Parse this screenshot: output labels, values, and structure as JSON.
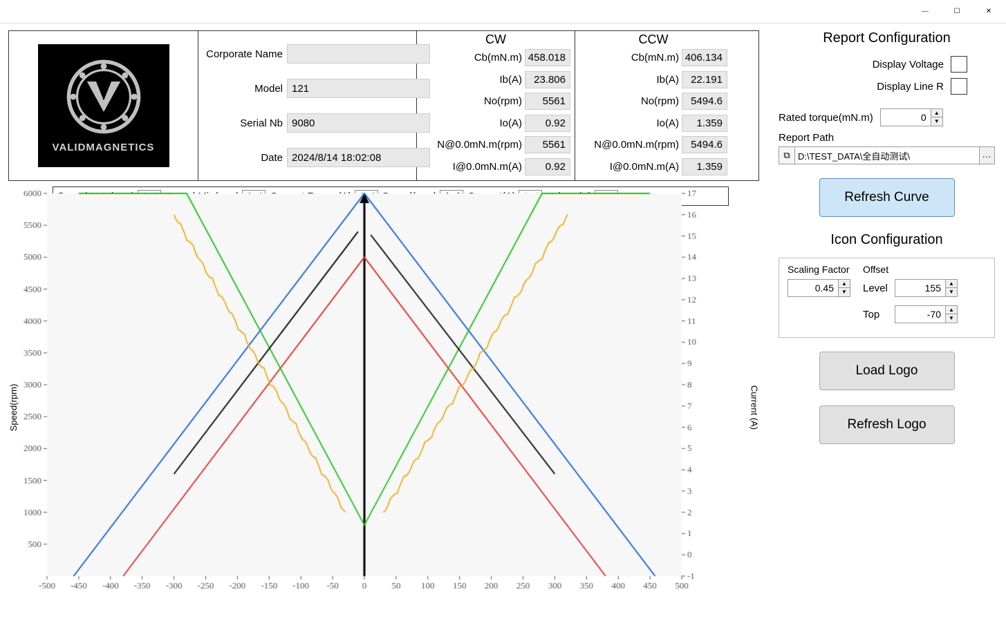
{
  "window": {
    "minimize": "—",
    "maximize": "☐",
    "close": "✕"
  },
  "logo_text": "VALIDMAGNETICS",
  "form": {
    "corp_label": "Corporate Name",
    "corp_value": "",
    "model_label": "Model",
    "model_value": "121",
    "serial_label": "Serial Nb",
    "serial_value": "9080",
    "date_label": "Date",
    "date_value": "2024/8/14 18:02:08"
  },
  "cw": {
    "header": "CW",
    "rows": [
      {
        "label": "Cb(mN.m)",
        "value": "458.018"
      },
      {
        "label": "Ib(A)",
        "value": "23.806"
      },
      {
        "label": "No(rpm)",
        "value": "5561"
      },
      {
        "label": "Io(A)",
        "value": "0.92"
      },
      {
        "label": "N@0.0mN.m(rpm)",
        "value": "5561"
      },
      {
        "label": "I@0.0mN.m(A)",
        "value": "0.92"
      }
    ]
  },
  "ccw": {
    "header": "CCW",
    "rows": [
      {
        "label": "Cb(mN.m)",
        "value": "406.134"
      },
      {
        "label": "Ib(A)",
        "value": "22.191"
      },
      {
        "label": "No(rpm)",
        "value": "5494.6"
      },
      {
        "label": "Io(A)",
        "value": "1.359"
      },
      {
        "label": "N@0.0mN.m(rpm)",
        "value": "5494.6"
      },
      {
        "label": "I@0.0mN.m(A)",
        "value": "1.359"
      }
    ]
  },
  "legend": [
    {
      "name": "Speed Max(rpm)",
      "color": "#1060d0"
    },
    {
      "name": "Speed Min(rpm)",
      "color": "#e03030"
    },
    {
      "name": "Current Range(A)",
      "color": "#20c020"
    },
    {
      "name": "Speed(rpm)",
      "color": "#000000"
    },
    {
      "name": "Current(A)",
      "color": "#e8b020"
    },
    {
      "name": "Volage(V)",
      "color": "#c0a0e0"
    }
  ],
  "axis": {
    "y_left": "Speed(rpm)",
    "y_right": "Current (A)"
  },
  "report_cfg": {
    "title": "Report Configuration",
    "disp_voltage": "Display Voltage",
    "disp_line_r": "Display Line R",
    "rated_torque_label": "Rated torque(mN.m)",
    "rated_torque_value": "0",
    "report_path_label": "Report Path",
    "report_path_value": "D:\\TEST_DATA\\全自动测试\\",
    "refresh_curve": "Refresh Curve"
  },
  "icon_cfg": {
    "title": "Icon Configuration",
    "scaling_factor_label": "Scaling Factor",
    "scaling_factor_value": "0.45",
    "offset_label": "Offset",
    "level_label": "Level",
    "level_value": "155",
    "top_label": "Top",
    "top_value": "-70",
    "load_logo": "Load Logo",
    "refresh_logo": "Refresh Logo"
  },
  "chart_data": {
    "type": "line",
    "xlim": [
      -500,
      500
    ],
    "y_left_lim": [
      0,
      6000
    ],
    "y_right_lim": [
      -1,
      17
    ],
    "x_ticks": [
      -500,
      -450,
      -400,
      -350,
      -300,
      -250,
      -200,
      -150,
      -100,
      -50,
      0,
      50,
      100,
      150,
      200,
      250,
      300,
      350,
      400,
      450,
      500
    ],
    "yl_ticks": [
      500,
      1000,
      1500,
      2000,
      2500,
      3000,
      3500,
      4000,
      4500,
      5000,
      5500,
      6000
    ],
    "yr_ticks": [
      -1,
      0,
      1,
      2,
      3,
      4,
      5,
      6,
      7,
      8,
      9,
      10,
      11,
      12,
      13,
      14,
      15,
      16,
      17
    ],
    "series": [
      {
        "name": "Speed Max(rpm)",
        "color": "#1060d0",
        "axis": "left",
        "points": [
          [
            -458,
            0
          ],
          [
            0,
            6000
          ],
          [
            458,
            0
          ]
        ]
      },
      {
        "name": "Speed Min(rpm)",
        "color": "#e03030",
        "axis": "left",
        "points": [
          [
            -380,
            0
          ],
          [
            0,
            5000
          ],
          [
            380,
            0
          ]
        ]
      },
      {
        "name": "Current Range(A)",
        "color": "#20c020",
        "axis": "left",
        "points": [
          [
            -450,
            6000
          ],
          [
            -280,
            6000
          ],
          [
            0,
            800
          ],
          [
            280,
            6000
          ],
          [
            450,
            6000
          ]
        ]
      },
      {
        "name": "Speed(rpm)",
        "color": "#000000",
        "axis": "left",
        "points_neg": [
          [
            -300,
            1600
          ],
          [
            -10,
            5400
          ]
        ],
        "points_pos": [
          [
            10,
            5350
          ],
          [
            300,
            1600
          ]
        ]
      },
      {
        "name": "Current(A)",
        "color": "#e8b020",
        "axis": "right",
        "points_neg": [
          [
            -300,
            16
          ],
          [
            -30,
            2
          ]
        ],
        "points_pos": [
          [
            30,
            2
          ],
          [
            320,
            16
          ]
        ]
      }
    ]
  }
}
